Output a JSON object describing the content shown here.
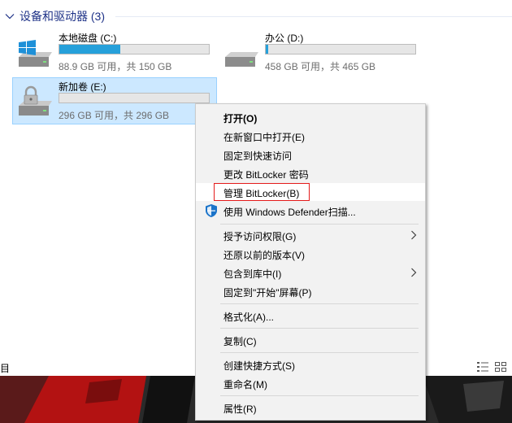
{
  "section": {
    "title": "设备和驱动器 (3)"
  },
  "drives": [
    {
      "name": "本地磁盘 (C:)",
      "info": "88.9 GB 可用，共 150 GB",
      "used_fraction": 0.41,
      "icon": "windows-drive-icon",
      "selected": false
    },
    {
      "name": "办公 (D:)",
      "info": "458 GB 可用，共 465 GB",
      "used_fraction": 0.015,
      "icon": "hard-drive-icon",
      "selected": false
    },
    {
      "name": "新加卷 (E:)",
      "info": "296 GB 可用，共 296 GB",
      "used_fraction": 0.0,
      "icon": "bitlocker-drive-icon",
      "selected": true
    }
  ],
  "status_bar": {
    "left_text": "目"
  },
  "context_menu": {
    "items": [
      {
        "label": "打开(O)",
        "bold": true
      },
      {
        "label": "在新窗口中打开(E)"
      },
      {
        "label": "固定到快速访问"
      },
      {
        "label": "更改 BitLocker 密码"
      },
      {
        "label": "管理 BitLocker(B)",
        "highlighted": true
      },
      {
        "label": "使用 Windows Defender扫描...",
        "icon": "defender-shield-icon"
      },
      {
        "label": "授予访问权限(G)",
        "submenu": true
      },
      {
        "label": "还原以前的版本(V)"
      },
      {
        "label": "包含到库中(I)",
        "submenu": true
      },
      {
        "label": "固定到\"开始\"屏幕(P)"
      },
      {
        "label": "格式化(A)..."
      },
      {
        "label": "复制(C)"
      },
      {
        "label": "创建快捷方式(S)"
      },
      {
        "label": "重命名(M)"
      },
      {
        "label": "属性(R)"
      }
    ]
  },
  "colors": {
    "accent": "#26a0da",
    "selection": "#cce8ff",
    "highlight_box": "#e41b1b",
    "header_text": "#1e3287"
  }
}
